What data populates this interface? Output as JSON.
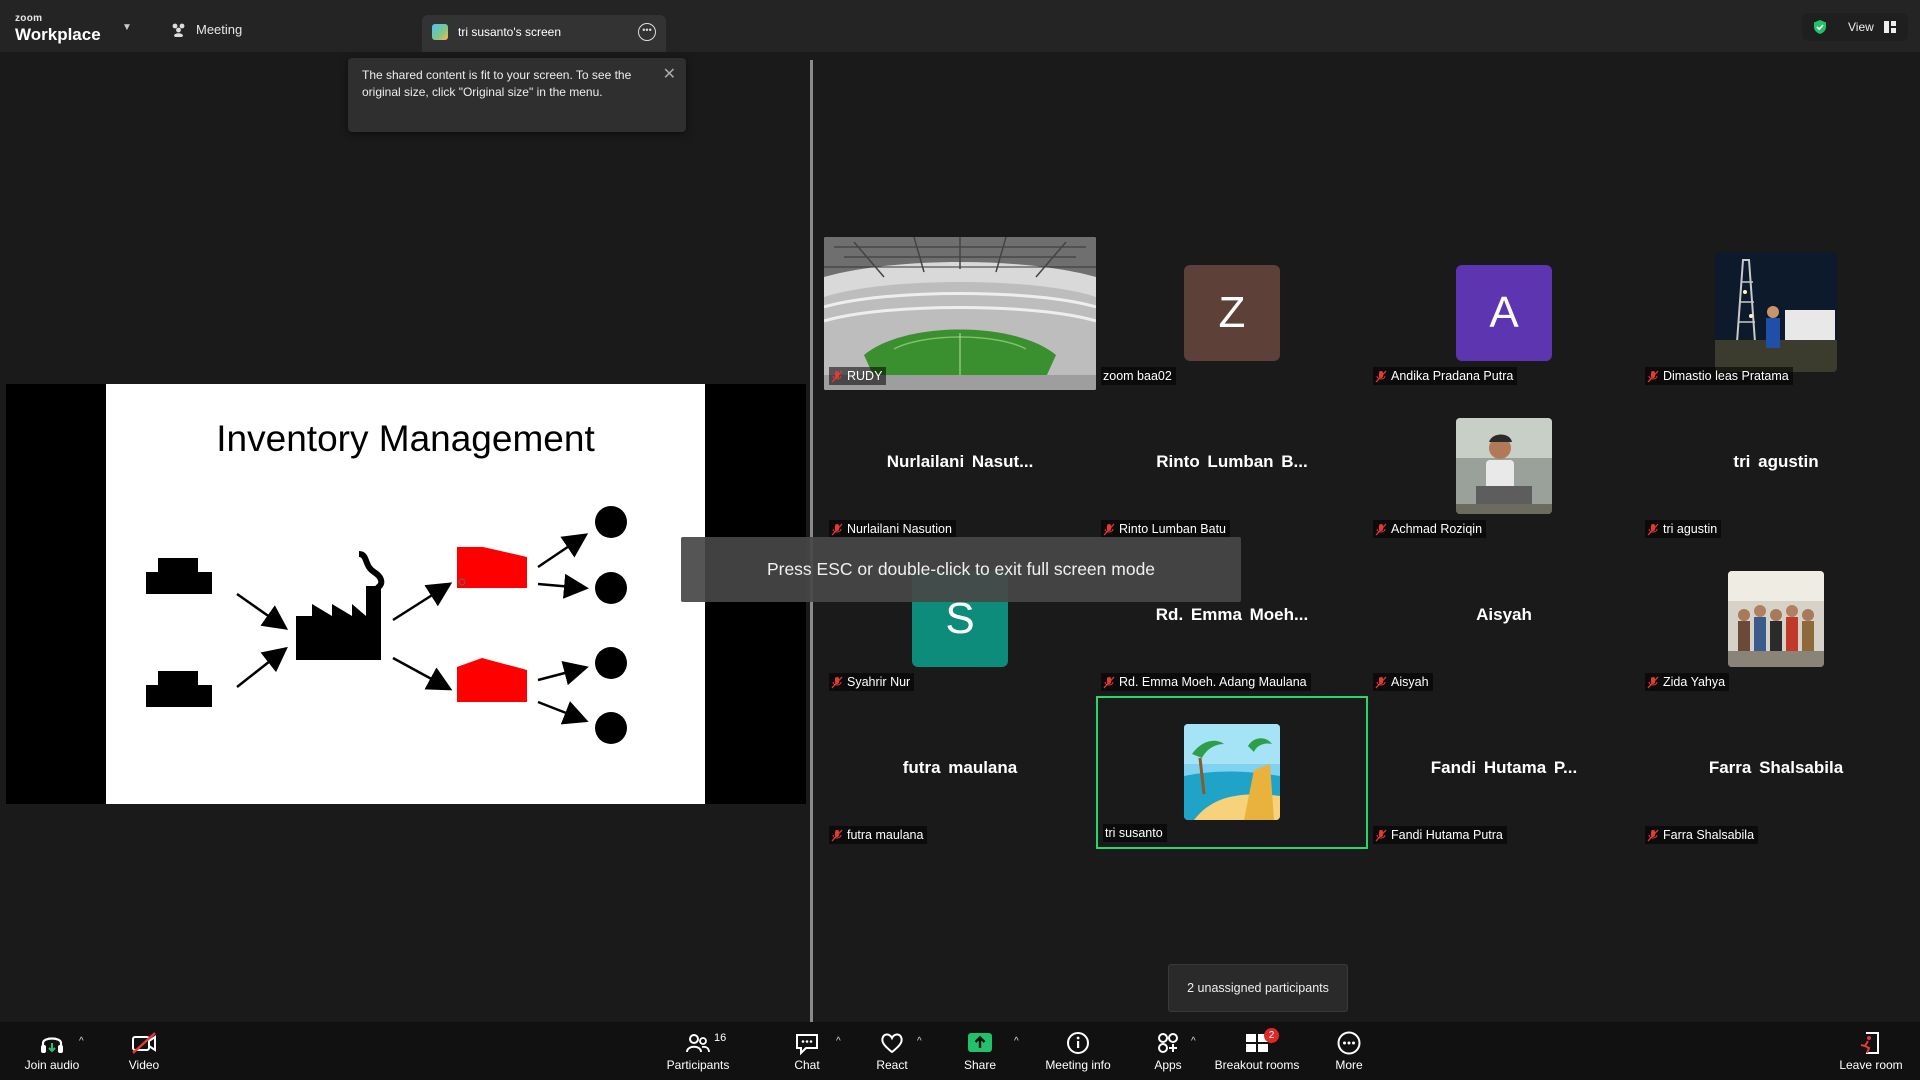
{
  "app": {
    "brand_small": "zoom",
    "brand_big": "Workplace",
    "meeting_label": "Meeting"
  },
  "share_tab": {
    "label": "tri susanto's screen"
  },
  "view_button": {
    "label": "View"
  },
  "tooltip": {
    "text": "The shared content is fit to your screen. To see the original size, click \"Original size\" in the menu."
  },
  "slide": {
    "title": "Inventory Management"
  },
  "esc_message": "Press ESC or double-click to exit full screen mode",
  "unassigned_tooltip": "2 unassigned participants",
  "participants": [
    {
      "name": "RUDY",
      "type": "video-stadium"
    },
    {
      "name": "zoom baa02",
      "type": "avatar",
      "letter": "Z",
      "color": "#5d4037"
    },
    {
      "name": "Andika Pradana Putra",
      "type": "avatar",
      "letter": "A",
      "color": "#5e35b1"
    },
    {
      "name": "Dimastio leas Pratama",
      "type": "photo-rig"
    },
    {
      "name": "Nurlailani Nasution",
      "display": "Nurlailani  Nasut...",
      "type": "text"
    },
    {
      "name": "Rinto Lumban Batu",
      "display": "Rinto  Lumban  B...",
      "type": "text"
    },
    {
      "name": "Achmad Roziqin",
      "type": "photo-person"
    },
    {
      "name": "tri agustin",
      "display": "tri agustin",
      "type": "text"
    },
    {
      "name": "Syahrir Nur",
      "type": "avatar",
      "letter": "S",
      "color": "#0d8c7c"
    },
    {
      "name": "Rd. Emma Moeh. Adang Maulana",
      "display": "Rd.  Emma  Moeh...",
      "type": "text"
    },
    {
      "name": "Aisyah",
      "display": "Aisyah",
      "type": "text"
    },
    {
      "name": "Zida Yahya",
      "type": "photo-group"
    },
    {
      "name": "futra maulana",
      "display": "futra maulana",
      "type": "text"
    },
    {
      "name": "tri susanto",
      "type": "photo-beach",
      "active": true
    },
    {
      "name": "Fandi Hutama Putra",
      "display": "Fandi  Hutama  P...",
      "type": "text"
    },
    {
      "name": "Farra Shalsabila",
      "display": "Farra Shalsabila",
      "type": "text"
    }
  ],
  "toolbar": {
    "join_audio": "Join audio",
    "video": "Video",
    "participants": "Participants",
    "participants_count": "16",
    "chat": "Chat",
    "react": "React",
    "share": "Share",
    "meeting_info": "Meeting info",
    "apps": "Apps",
    "breakout_rooms": "Breakout rooms",
    "breakout_badge": "2",
    "more": "More",
    "leave_room": "Leave room"
  },
  "colors": {
    "active_border": "#23d96b",
    "share_green": "#23c16b",
    "badge_red": "#e02828",
    "muted_red": "#e53935"
  }
}
